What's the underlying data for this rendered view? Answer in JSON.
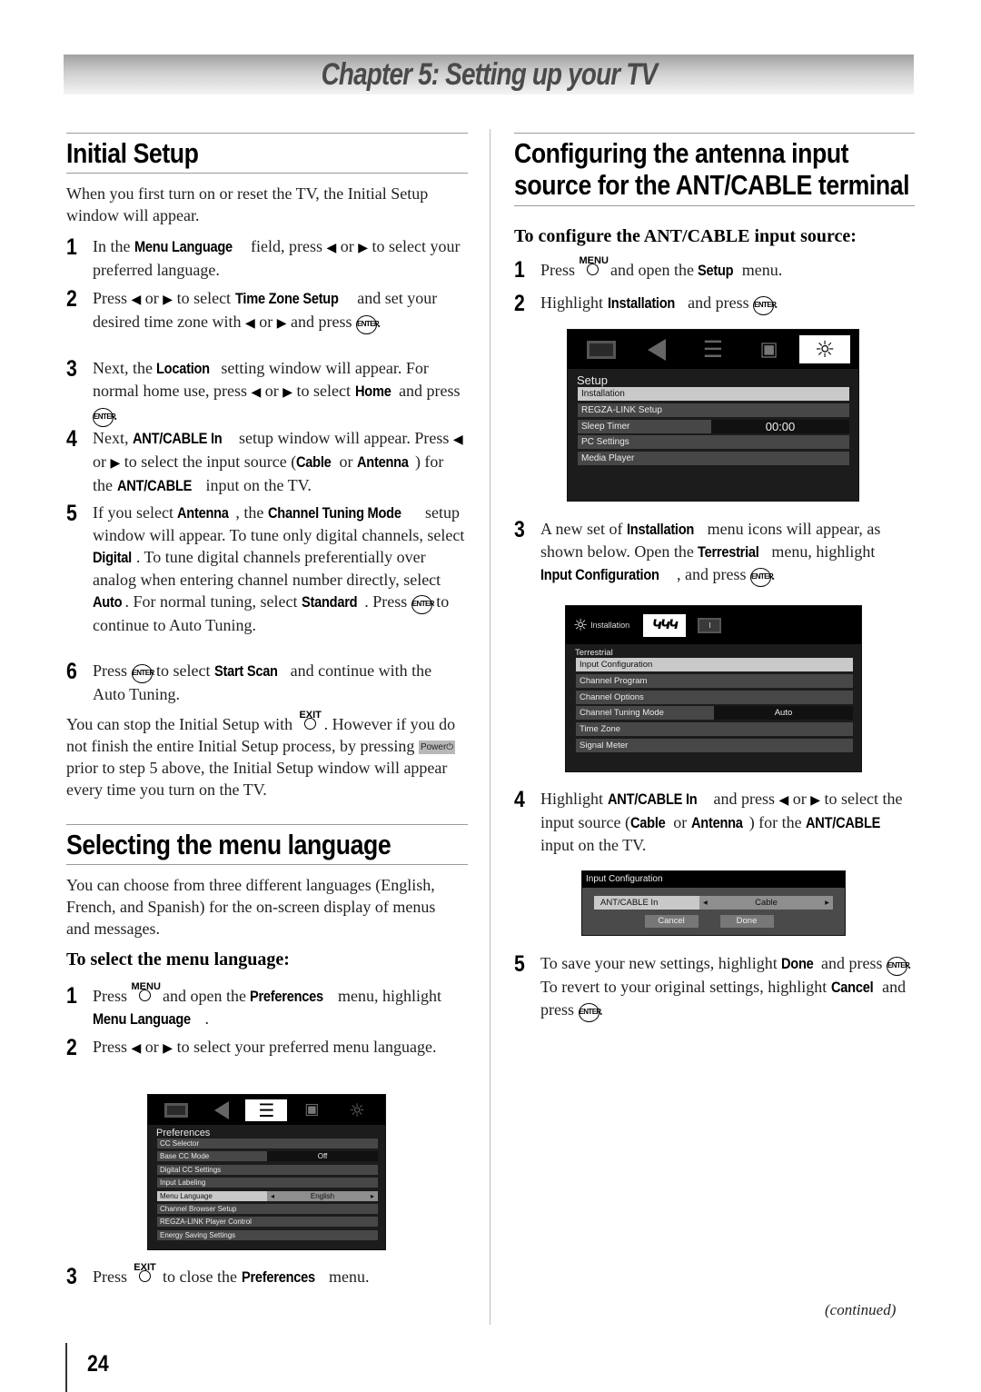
{
  "chapter": {
    "title": "Chapter 5: Setting up your TV"
  },
  "initial_setup": {
    "heading": "Initial Setup",
    "intro": "When you first turn on or reset the TV, the Initial Setup window will appear.",
    "steps": [
      {
        "num": "1",
        "parts": [
          "In the ",
          "Menu Language",
          " field, press ",
          "◀",
          " or ",
          "▶",
          " to select  your preferred language."
        ]
      },
      {
        "num": "2",
        "parts": [
          "Press ",
          "◀",
          " or ",
          "▶",
          " to select ",
          "Time Zone Setup",
          " and set your desired time zone with ",
          "◀",
          " or ",
          "▶",
          " and press ",
          "ENTER",
          "."
        ]
      },
      {
        "num": "3",
        "parts": [
          "Next, the ",
          "Location",
          " setting window will appear. For normal home use, press ",
          "◀",
          " or ",
          "▶",
          " to select ",
          "Home",
          " and press ",
          "ENTER",
          "."
        ]
      },
      {
        "num": "4",
        "parts": [
          "Next, ",
          "ANT/CABLE In",
          " setup window will appear. Press ",
          "◀",
          " or ",
          "▶",
          " to select the input source (",
          "Cable",
          " or ",
          "Antenna",
          ") for the ",
          "ANT/CABLE",
          " input on the TV."
        ]
      },
      {
        "num": "5",
        "parts": [
          "If you select ",
          "Antenna",
          ", the ",
          "Channel Tuning Mode",
          " setup window will appear. To tune only digital channels, select ",
          "Digital",
          ". To tune digital channels preferentially over analog when entering channel number directly, select ",
          "Auto",
          ". For normal tuning, select ",
          "Standard",
          ". Press ",
          "ENTER",
          " to continue to Auto Tuning."
        ]
      },
      {
        "num": "6",
        "parts": [
          "Press ",
          "ENTER",
          " to select ",
          "Start Scan",
          " and continue with the Auto Tuning."
        ]
      }
    ],
    "note_parts": [
      "You can stop the Initial Setup with ",
      "EXIT",
      ". However if you do not finish the entire Initial Setup process, by pressing ",
      "Power",
      " prior to step 5 above, the Initial Setup window will appear every time you turn on the TV."
    ]
  },
  "menu_language": {
    "heading": "Selecting the menu language",
    "intro": "You can choose from three different languages (English, French, and Spanish) for the on-screen display of menus and messages.",
    "subheading": "To select the menu language:",
    "steps": [
      {
        "num": "1",
        "parts": [
          "Press ",
          "MENU",
          " and open the ",
          "Preferences",
          " menu, highlight ",
          "Menu Language",
          "."
        ]
      },
      {
        "num": "2",
        "parts": [
          "Press ",
          "◀",
          " or ",
          "▶",
          " to select your preferred menu language."
        ]
      },
      {
        "num": "3",
        "parts": [
          "Press ",
          "EXIT",
          " to close the ",
          "Preferences",
          " menu."
        ]
      }
    ],
    "screen": {
      "tabs": [
        "picture-icon",
        "audio-icon",
        "preferences-icon",
        "lock-icon",
        "setup-icon"
      ],
      "active_tab": 2,
      "title": "Preferences",
      "rows": [
        {
          "label": "CC Selector"
        },
        {
          "label": "Base CC Mode",
          "value": "Off"
        },
        {
          "label": "Digital CC Settings"
        },
        {
          "label": "Input Labeling"
        },
        {
          "label": "Menu Language",
          "value": "English",
          "highlighted": true,
          "arrows": true
        },
        {
          "label": "Channel Browser Setup"
        },
        {
          "label": "REGZA-LINK Player Control"
        },
        {
          "label": "Energy Saving Settings"
        }
      ]
    }
  },
  "antenna_config": {
    "heading_line1": "Configuring the antenna input",
    "heading_line2": "source for the ANT/CABLE terminal",
    "subheading": "To configure the ANT/CABLE input source:",
    "steps": [
      {
        "num": "1",
        "parts": [
          "Press ",
          "MENU",
          " and open the ",
          "Setup",
          " menu."
        ]
      },
      {
        "num": "2",
        "parts": [
          "Highlight ",
          "Installation",
          " and press ",
          "ENTER",
          "."
        ]
      },
      {
        "num": "3",
        "parts": [
          "A new set of ",
          "Installation",
          " menu icons will appear, as shown below. Open the ",
          "Terrestrial",
          " menu, highlight ",
          "Input Configuration",
          ", and press ",
          "ENTER",
          "."
        ]
      },
      {
        "num": "4",
        "parts": [
          "Highlight ",
          "ANT/CABLE In",
          " and press ",
          "◀",
          " or ",
          "▶",
          " to select the input source (",
          "Cable",
          " or ",
          "Antenna",
          ") for the ",
          "ANT/CABLE",
          " input on the TV."
        ]
      },
      {
        "num": "5",
        "parts": [
          "To save your new settings, highlight ",
          "Done",
          " and press ",
          "ENTER",
          ". To revert to your original settings, highlight ",
          "Cancel",
          " and press ",
          "ENTER",
          "."
        ]
      }
    ],
    "setup_screen": {
      "active_tab": 4,
      "title": "Setup",
      "rows": [
        {
          "label": "Installation",
          "highlighted": true
        },
        {
          "label": "REGZA-LINK Setup"
        },
        {
          "label": "Sleep Timer",
          "value": "00:00"
        },
        {
          "label": "PC Settings"
        },
        {
          "label": "Media Player"
        }
      ]
    },
    "installation_screen": {
      "header_label": "Installation",
      "title": "Terrestrial",
      "rows": [
        {
          "label": "Input Configuration",
          "highlighted": true
        },
        {
          "label": "Channel Program"
        },
        {
          "label": "Channel Options"
        },
        {
          "label": "Channel Tuning Mode",
          "value": "Auto"
        },
        {
          "label": "Time Zone"
        },
        {
          "label": "Signal Meter"
        }
      ]
    },
    "input_config_dialog": {
      "title": "Input Configuration",
      "field_label": "ANT/CABLE In",
      "field_value": "Cable",
      "cancel_label": "Cancel",
      "done_label": "Done"
    }
  },
  "footer": {
    "continued": "(continued)",
    "page_number": "24"
  },
  "button_labels": {
    "enter": "ENTER",
    "menu": "MENU",
    "exit": "EXIT",
    "power": "Power"
  }
}
